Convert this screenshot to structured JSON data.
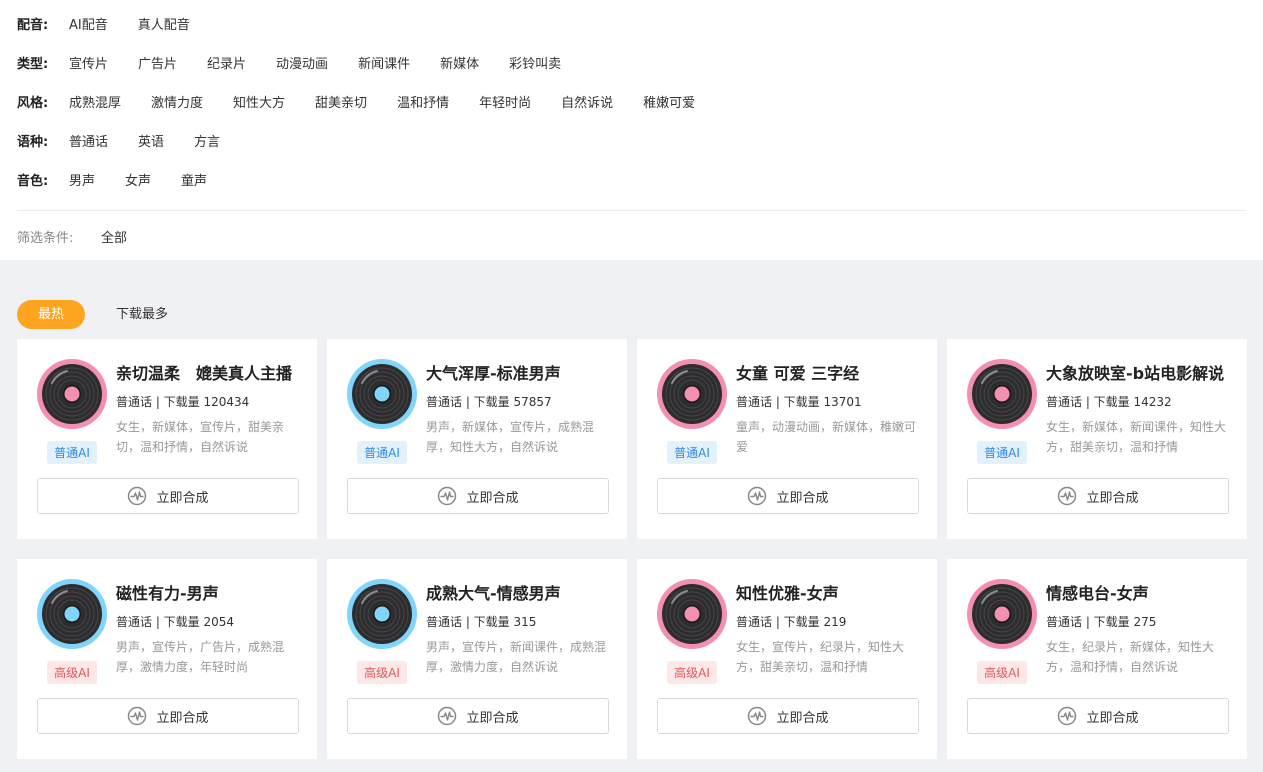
{
  "filters": [
    {
      "label": "配音:",
      "options": [
        "AI配音",
        "真人配音"
      ]
    },
    {
      "label": "类型:",
      "options": [
        "宣传片",
        "广告片",
        "纪录片",
        "动漫动画",
        "新闻课件",
        "新媒体",
        "彩铃叫卖"
      ]
    },
    {
      "label": "风格:",
      "options": [
        "成熟混厚",
        "激情力度",
        "知性大方",
        "甜美亲切",
        "温和抒情",
        "年轻时尚",
        "自然诉说",
        "稚嫩可爱"
      ]
    },
    {
      "label": "语种:",
      "options": [
        "普通话",
        "英语",
        "方言"
      ]
    },
    {
      "label": "音色:",
      "options": [
        "男声",
        "女声",
        "童声"
      ]
    }
  ],
  "conditions": {
    "label": "筛选条件:",
    "value": "全部"
  },
  "sort": {
    "active": "最热",
    "other": "下载最多"
  },
  "synth_label": "立即合成",
  "colors": {
    "pink": "#f48fb1",
    "blue": "#81d4fa",
    "accent": "#fda420"
  },
  "cards": [
    {
      "title": "亲切温柔　媲美真人主播",
      "meta": "普通话 | 下载量 120434",
      "tags": "女生，新媒体，宣传片，甜美亲切，温和抒情，自然诉说",
      "tier": "普通AI",
      "tier_type": "basic",
      "ring": "pink"
    },
    {
      "title": "大气浑厚-标准男声",
      "meta": "普通话 | 下载量 57857",
      "tags": "男声，新媒体，宣传片，成熟混厚，知性大方，自然诉说",
      "tier": "普通AI",
      "tier_type": "basic",
      "ring": "blue"
    },
    {
      "title": "女童 可爱 三字经",
      "meta": "普通话 | 下载量 13701",
      "tags": "童声，动漫动画，新媒体，稚嫩可爱",
      "tier": "普通AI",
      "tier_type": "basic",
      "ring": "pink"
    },
    {
      "title": "大象放映室-b站电影解说",
      "meta": "普通话 | 下载量 14232",
      "tags": "女生，新媒体，新闻课件，知性大方，甜美亲切，温和抒情",
      "tier": "普通AI",
      "tier_type": "basic",
      "ring": "pink"
    },
    {
      "title": "磁性有力-男声",
      "meta": "普通话 | 下载量 2054",
      "tags": "男声，宣传片，广告片，成熟混厚，激情力度，年轻时尚",
      "tier": "高级AI",
      "tier_type": "pro",
      "ring": "blue"
    },
    {
      "title": "成熟大气-情感男声",
      "meta": "普通话 | 下载量 315",
      "tags": "男声，宣传片，新闻课件，成熟混厚，激情力度，自然诉说",
      "tier": "高级AI",
      "tier_type": "pro",
      "ring": "blue"
    },
    {
      "title": "知性优雅-女声",
      "meta": "普通话 | 下载量 219",
      "tags": "女生，宣传片，纪录片，知性大方，甜美亲切，温和抒情",
      "tier": "高级AI",
      "tier_type": "pro",
      "ring": "pink"
    },
    {
      "title": "情感电台-女声",
      "meta": "普通话 | 下载量 275",
      "tags": "女生，纪录片，新媒体，知性大方，温和抒情，自然诉说",
      "tier": "高级AI",
      "tier_type": "pro",
      "ring": "pink"
    }
  ]
}
